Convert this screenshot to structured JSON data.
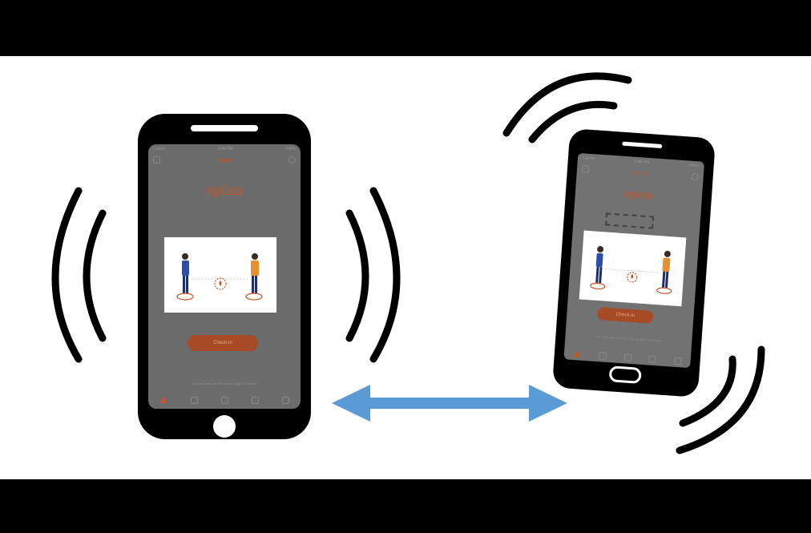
{
  "frame": {
    "background": "#ffffff",
    "letterbox": "#000000"
  },
  "left_phone": {
    "screen_title": "Home",
    "brand": "splan",
    "status_left": "Carrier",
    "status_time": "2:46 PM",
    "status_right": "100%",
    "caption": "",
    "button_label": "Check-in",
    "footnote": "You can scan this QR code to sign in & Shake",
    "tabs": [
      "home-icon",
      "calendar-icon",
      "clock-icon",
      "chat-icon",
      "more-icon"
    ]
  },
  "right_phone": {
    "screen_title": "Home",
    "brand": "splan",
    "status_left": "Carrier",
    "status_time": "2:46 PM",
    "status_right": "100%",
    "button_label": "Check-in",
    "footnote": "You can scan this QR code to sign in & Shake",
    "tabs": [
      "home-icon",
      "calendar-icon",
      "clock-icon",
      "chat-icon",
      "more-icon"
    ]
  },
  "colors": {
    "brand": "#c0562a",
    "button": "#a74a26",
    "arrow": "#5b9bd5",
    "person_blue": "#2a4fa8",
    "person_orange": "#e8902f"
  },
  "icons": {
    "arrow": "double-headed-arrow-icon",
    "waves": "vibration-waves-icon"
  }
}
